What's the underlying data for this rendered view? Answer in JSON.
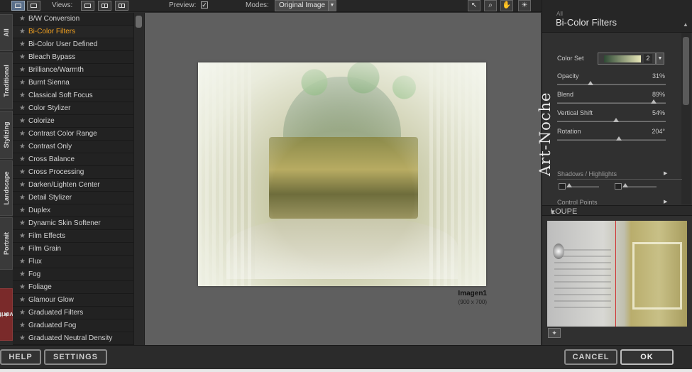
{
  "toolbar": {
    "views_label": "Views:",
    "preview_label": "Preview:",
    "preview_checked": "✓",
    "modes_label": "Modes:",
    "mode_value": "Original Image"
  },
  "category_tabs": [
    "All",
    "Traditional",
    "Stylizing",
    "Landscape",
    "Portrait",
    "Favorites"
  ],
  "filters": [
    "B/W Conversion",
    "Bi-Color Filters",
    "Bi-Color User Defined",
    "Bleach Bypass",
    "Brilliance/Warmth",
    "Burnt Sienna",
    "Classical Soft Focus",
    "Color Stylizer",
    "Colorize",
    "Contrast Color Range",
    "Contrast Only",
    "Cross Balance",
    "Cross Processing",
    "Darken/Lighten Center",
    "Detail Stylizer",
    "Duplex",
    "Dynamic Skin Softener",
    "Film Effects",
    "Film Grain",
    "Flux",
    "Fog",
    "Foliage",
    "Glamour Glow",
    "Graduated Filters",
    "Graduated Fog",
    "Graduated Neutral Density"
  ],
  "selected_filter": "Bi-Color Filters",
  "preview": {
    "image_name": "Imagen1",
    "image_dims": "(900 x 700)"
  },
  "panel": {
    "category": "All",
    "title": "Bi-Color Filters",
    "color_set_label": "Color Set",
    "color_set_value": "2",
    "opacity_label": "Opacity",
    "opacity_value": "31%",
    "opacity_level": 0.31,
    "blend_label": "Blend",
    "blend_value": "89%",
    "blend_level": 0.89,
    "vshift_label": "Vertical Shift",
    "vshift_value": "54%",
    "vshift_level": 0.54,
    "rotation_label": "Rotation",
    "rotation_value": "204°",
    "rotation_level": 0.57,
    "shadows_label": "Shadows / Highlights",
    "control_points_label": "Control Points",
    "loupe_label": "LOUPE"
  },
  "watermark": "Art-Noche",
  "buttons": {
    "help": "HELP",
    "settings": "SETTINGS",
    "cancel": "CANCEL",
    "ok": "OK"
  },
  "colors": {
    "selected_filter": "#f0a020",
    "favorites_tab": "#7a2a2a",
    "loupe_line": "#d03030"
  }
}
